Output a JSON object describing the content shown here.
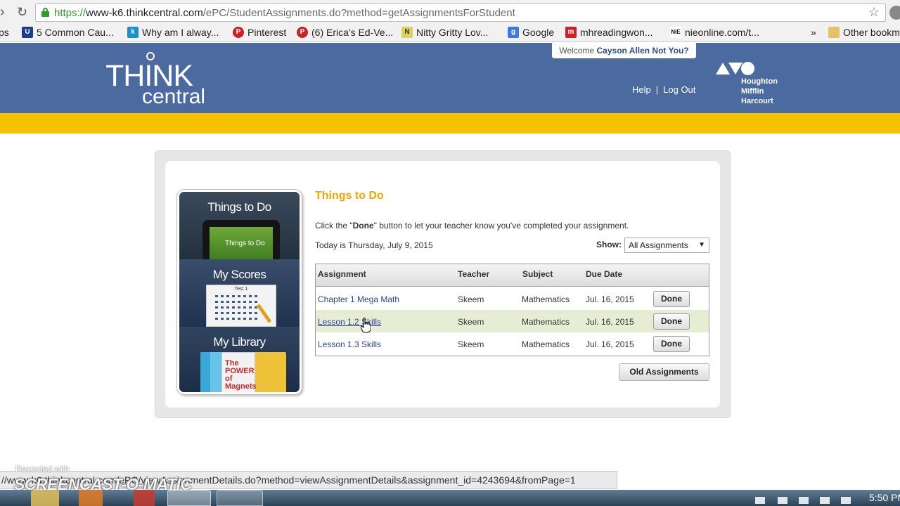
{
  "browser": {
    "url_scheme": "https://",
    "url_host": "www-k6.thinkcentral.com",
    "url_path": "/ePC/StudentAssignments.do?method=getAssignmentsForStudent",
    "bookmarks": [
      {
        "label": "ps",
        "icon": "apps-icon"
      },
      {
        "label": "5 Common Cau...",
        "icon": "usn-icon"
      },
      {
        "label": "Why am I alway...",
        "icon": "k-icon"
      },
      {
        "label": "Pinterest",
        "icon": "pinterest-icon"
      },
      {
        "label": "(6) Erica's Ed-Ve...",
        "icon": "pinterest-icon"
      },
      {
        "label": "Nitty Gritty Lov...",
        "icon": "n-icon"
      },
      {
        "label": "Google",
        "icon": "google-icon"
      },
      {
        "label": "mhreadingwon...",
        "icon": "mh-icon"
      },
      {
        "label": "nieonline.com/t...",
        "icon": "nie-icon"
      },
      {
        "label": "»",
        "icon": ""
      },
      {
        "label": "Other bookm",
        "icon": "folder-icon"
      }
    ]
  },
  "header": {
    "logo_think": "THINK",
    "logo_central": "central",
    "welcome_prefix": "Welcome",
    "user_name": "Cayson Allen",
    "not_you": "Not You?",
    "help": "Help",
    "separator": "|",
    "logout": "Log Out",
    "publisher_lines": [
      "Houghton",
      "Mifflin",
      "Harcourt"
    ]
  },
  "sidebar": {
    "items": [
      {
        "label": "Things to Do",
        "thumb_text": "Things to Do"
      },
      {
        "label": "My Scores",
        "thumb_text": "Test 1"
      },
      {
        "label": "My Library",
        "thumb_text": "The POWER of Magnets"
      }
    ]
  },
  "main": {
    "title": "Things to Do",
    "instructions_pre": "Click the \"",
    "instructions_bold": "Done",
    "instructions_post": "\" button to let your teacher know you've completed your assignment.",
    "today": "Today is Thursday, July 9, 2015",
    "show_label": "Show:",
    "show_value": "All Assignments",
    "columns": [
      "Assignment",
      "Teacher",
      "Subject",
      "Due Date"
    ],
    "rows": [
      {
        "assignment": "Chapter 1 Mega Math",
        "teacher": "Skeem",
        "subject": "Mathematics",
        "due": "Jul. 16, 2015",
        "button": "Done"
      },
      {
        "assignment": "Lesson 1.2 Skills",
        "teacher": "Skeem",
        "subject": "Mathematics",
        "due": "Jul. 16, 2015",
        "button": "Done"
      },
      {
        "assignment": "Lesson 1.3 Skills",
        "teacher": "Skeem",
        "subject": "Mathematics",
        "due": "Jul. 16, 2015",
        "button": "Done"
      }
    ],
    "old_button": "Old Assignments"
  },
  "status_bar": {
    "text": "//www-k6.thinkcentral.com/ePC/viewAssignmentDetails.do?method=viewAssignmentDetails&assignment_id=4243694&fromPage=1"
  },
  "watermark": {
    "small": "Recorded with",
    "big": "SCREENCAST-O-MATIC"
  },
  "taskbar": {
    "clock": "5:50 PM"
  },
  "colors": {
    "header_blue": "#4a6aa0",
    "gold_bar": "#f6c200",
    "title_gold": "#f0a800",
    "link_blue": "#2d3fa3",
    "row_highlight": "#e6edd2"
  }
}
